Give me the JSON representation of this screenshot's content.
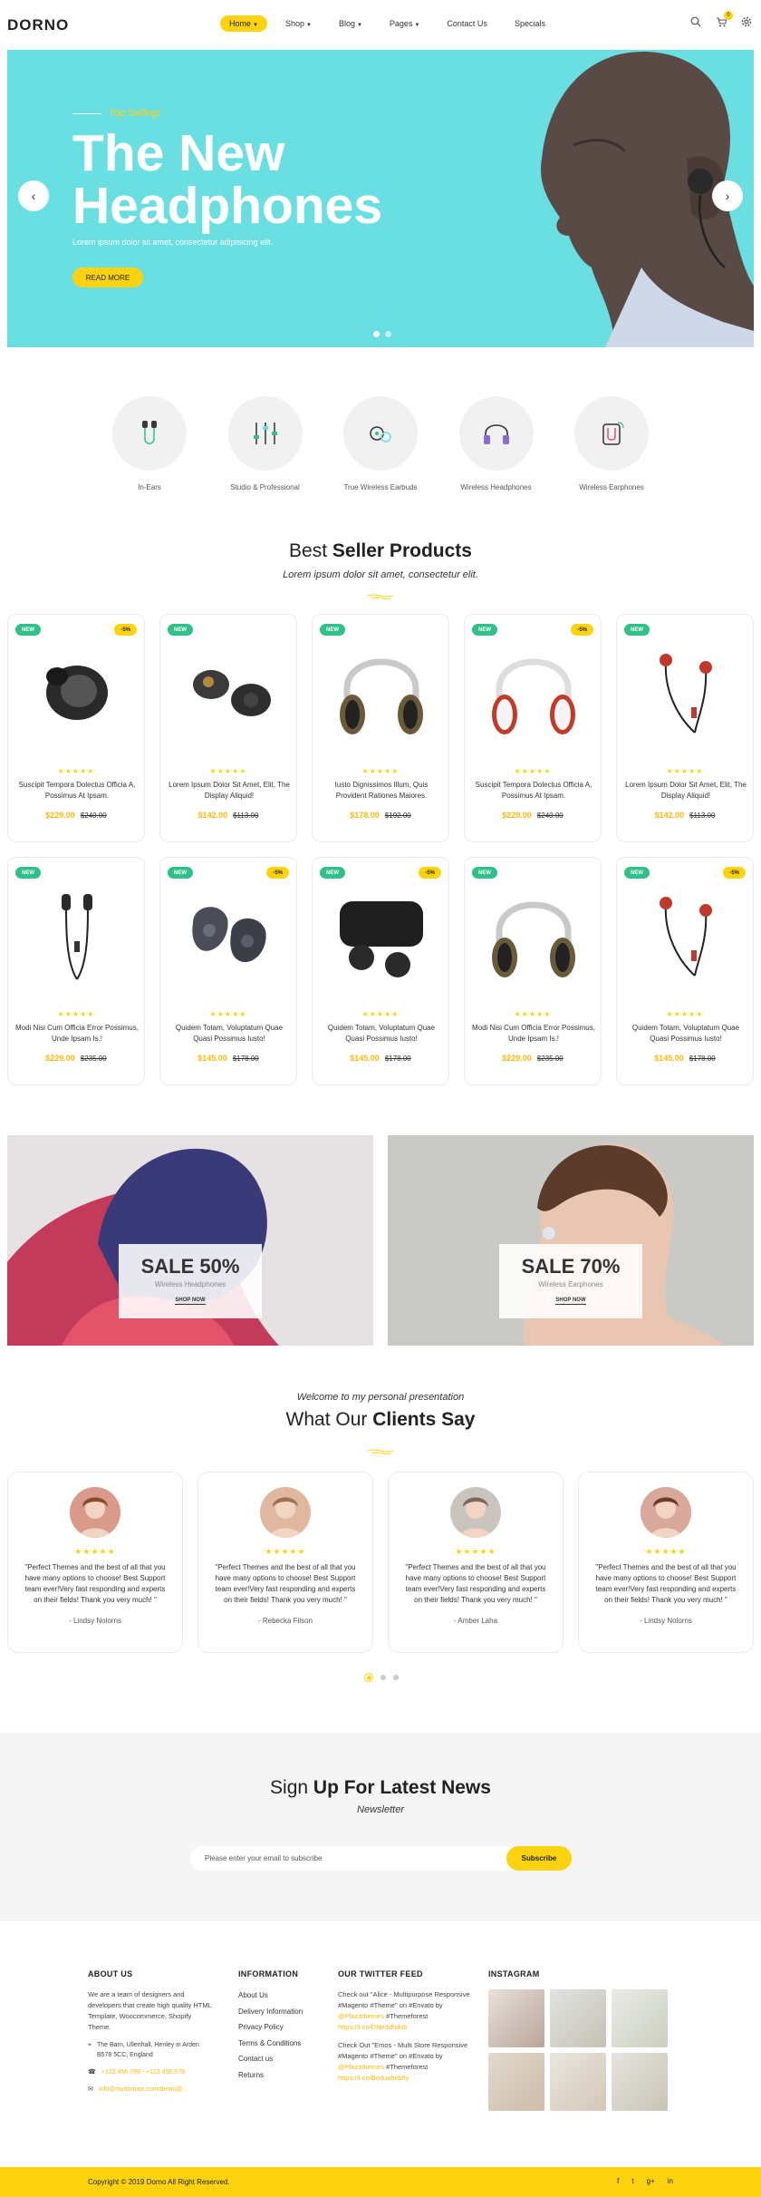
{
  "header": {
    "logo": "DORNO",
    "nav": [
      {
        "label": "Home",
        "active": true,
        "caret": true
      },
      {
        "label": "Shop",
        "caret": true
      },
      {
        "label": "Blog",
        "caret": true
      },
      {
        "label": "Pages",
        "caret": true
      },
      {
        "label": "Contact Us"
      },
      {
        "label": "Specials"
      }
    ],
    "cart_count": "0",
    "icons": [
      "search-icon",
      "cart-icon",
      "gear-icon"
    ]
  },
  "hero": {
    "tag": "Top Selling!",
    "title": "The New Headphones",
    "subtitle": "Lorem ipsum dolor sit amet, consectetur adipisicing elit.",
    "button": "READ MORE",
    "prev": "‹",
    "next": "›"
  },
  "categories": [
    {
      "label": "In-Ears"
    },
    {
      "label": "Studio & Professional"
    },
    {
      "label": "True Wireless Earbuds"
    },
    {
      "label": "Wireless Headphones"
    },
    {
      "label": "Wireless Earphones"
    }
  ],
  "best": {
    "title_light": "Best ",
    "title_bold": "Seller Products",
    "subtitle": "Lorem ipsum dolor sit amet, consectetur elit."
  },
  "products_row1": [
    {
      "name": "Suscipit Tempora Dolectus Officia A, Possimus At Ipsam.",
      "now": "$229.00",
      "old": "$240.00",
      "new": "NEW",
      "off": "-5%"
    },
    {
      "name": "Lorem Ipsum Dolor Sit Amet, Elit, The Display Aliquid!",
      "now": "$142.00",
      "old": "$113.00",
      "new": "NEW",
      "off": ""
    },
    {
      "name": "Iusto Dignissimos Illum, Quis Provident Rationes Maiores.",
      "now": "$178.00",
      "old": "$192.00",
      "new": "NEW",
      "off": ""
    },
    {
      "name": "Suscipit Tempora Dolectus Officia A, Possimus At Ipsam.",
      "now": "$229.00",
      "old": "$240.00",
      "new": "NEW",
      "off": "-5%"
    },
    {
      "name": "Lorem Ipsum Dolor Sit Amet, Elit, The Display Aliquid!",
      "now": "$142.00",
      "old": "$113.00",
      "new": "NEW",
      "off": ""
    }
  ],
  "products_row2": [
    {
      "name": "Modi Nisi Cum Officia Error Possimus, Unde Ipsam Is.!",
      "now": "$229.00",
      "old": "$235.00",
      "new": "NEW",
      "off": ""
    },
    {
      "name": "Quidem Totam, Voluptatum Quae Quasi Possimus Iusto!",
      "now": "$145.00",
      "old": "$178.00",
      "new": "NEW",
      "off": "-5%"
    },
    {
      "name": "Quidem Totam, Voluptatum Quae Quasi Possimus Iusto!",
      "now": "$145.00",
      "old": "$178.00",
      "new": "NEW",
      "off": "-5%"
    },
    {
      "name": "Modi Nisi Cum Officia Error Possimus, Unde Ipsam Is.!",
      "now": "$229.00",
      "old": "$235.00",
      "new": "NEW",
      "off": ""
    },
    {
      "name": "Quidem Totam, Voluptatum Quae Quasi Possimus Iusto!",
      "now": "$145.00",
      "old": "$178.00",
      "new": "NEW",
      "off": "-5%"
    }
  ],
  "stars": "★★★★★",
  "banners": [
    {
      "title": "SALE 50%",
      "sub": "Wireless Headphones",
      "link": "SHOP NOW"
    },
    {
      "title": "SALE 70%",
      "sub": "Wireless Earphones",
      "link": "SHOP NOW"
    }
  ],
  "clients": {
    "welcome": "Welcome to my personal presentation",
    "title_light": "What Our ",
    "title_bold": "Clients Say",
    "items": [
      {
        "quote": "\"Perfect Themes and the best of all that you have many options to choose! Best Support team ever!Very fast responding and experts on their fields! Thank you very much! \"",
        "name": "- Lindsy Nolorns"
      },
      {
        "quote": "\"Perfect Themes and the best of all that you have many options to choose! Best Support team ever!Very fast responding and experts on their fields! Thank you very much! \"",
        "name": "- Rebecka Filson"
      },
      {
        "quote": "\"Perfect Themes and the best of all that you have many options to choose! Best Support team ever!Very fast responding and experts on their fields! Thank you very much! \"",
        "name": "- Amber Laha"
      },
      {
        "quote": "\"Perfect Themes and the best of all that you have many options to choose! Best Support team ever!Very fast responding and experts on their fields! Thank you very much! \"",
        "name": "- Lindsy Nolorns"
      }
    ]
  },
  "news": {
    "title_light": "Sign ",
    "title_bold": "Up For Latest News",
    "subtitle": "Newsletter",
    "placeholder": "Please enter your email to subscribe",
    "button": "Subscribe"
  },
  "footer": {
    "about": {
      "head": "ABOUT US",
      "text": "We are a team of designers and developers that create high quality HTML Template, Woocommerce, Shopify Theme.",
      "address": "The Barn, Ullenhall, Henley in Arden B578 5CC, England",
      "phone": "+123.456.789 - +123.456.678",
      "email": "info@mydomain.com/demo@..."
    },
    "info": {
      "head": "INFORMATION",
      "links": [
        "About Us",
        "Delivery Information",
        "Privacy Policy",
        "Terms & Conditions",
        "Contact us",
        "Returns"
      ]
    },
    "twitter": {
      "head": "OUR TWITTER FEED",
      "t1": "Check out \"Alice - Multipurpose Responsive #Magento #Theme\" on #Envato by",
      "t1a": "@Plazathemes",
      "t1b": "#Themeforest",
      "t1c": "https://t.co/DNe3dhds6",
      "t2": "Check Out \"Emos - Multi Store Responsive #Magento #Theme\" on #Envato by",
      "t2a": "@Plazathemes",
      "t2b": "#Themeforest",
      "t2c": "https://t.co/Boduahvb9y"
    },
    "instagram": {
      "head": "INSTAGRAM"
    },
    "copyright": "Copyright © 2019 Dorno All Right Reserved.",
    "social": [
      "f",
      "t",
      "g+",
      "in"
    ]
  },
  "colors": {
    "accent": "#fdd20e",
    "hero_bg": "#6adfe2",
    "new_badge": "#30c08a"
  }
}
